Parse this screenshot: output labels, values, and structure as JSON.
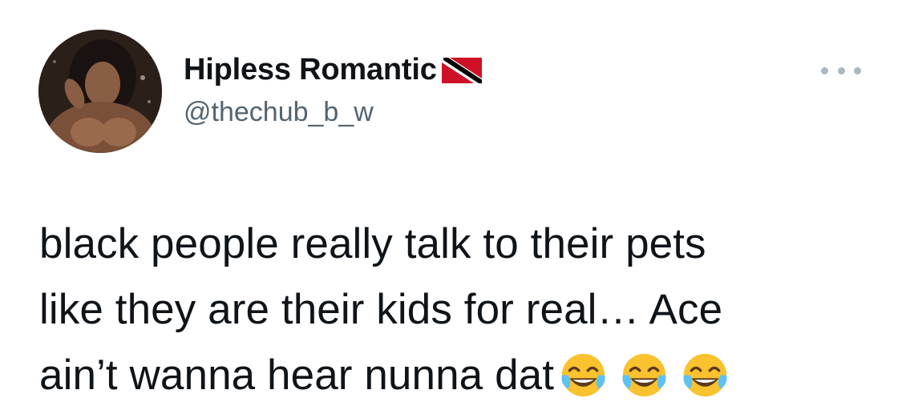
{
  "author": {
    "display_name": "Hipless Romantic",
    "handle": "@thechub_b_w",
    "flag_icon": "trinidad-and-tobago-flag"
  },
  "tweet": {
    "lines": [
      "black people really talk to their pets",
      "like they are their kids for real… Ace",
      "ain’t wanna hear nunna dat"
    ],
    "emojis": [
      "face-with-tears-of-joy",
      "face-with-tears-of-joy",
      "face-with-tears-of-joy"
    ]
  },
  "colors": {
    "text": "#0f1419",
    "secondary": "#536471",
    "more_dots": "#aab8c2",
    "flag_red": "#ce1126",
    "flag_black": "#000000",
    "emoji_yellow": "#f9c22e"
  }
}
